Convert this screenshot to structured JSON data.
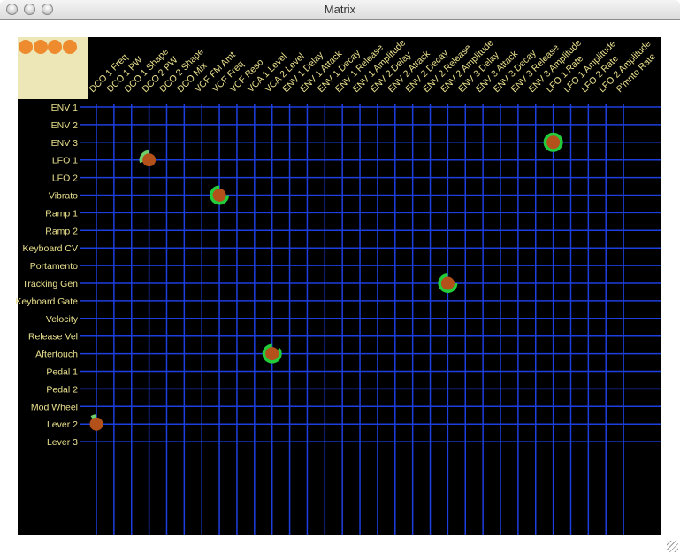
{
  "window": {
    "title": "Matrix"
  },
  "corner": {
    "indicator_count": 4,
    "indicator_color": "#ed8b2e"
  },
  "colors": {
    "grid": "#1e3fe0",
    "label": "#e9e08e",
    "dot": "#b4501a",
    "ring": "#22cc3a",
    "ring_dim": "#6ccf6a",
    "corner_bg": "#ede6b6"
  },
  "columns": [
    "DCO 1 Freq",
    "DCO 1 PW",
    "DCO 1 Shape",
    "DCO 2 PW",
    "DCO 2 Shape",
    "DCO Mix",
    "VCF FM Amt",
    "VCF Freq",
    "VCF Reso",
    "VCA 1 Level",
    "VCA 2 Level",
    "ENV 1 Delay",
    "ENV 1 Attack",
    "ENV 1 Decay",
    "ENV 1 Release",
    "ENV 1 Amplitude",
    "ENV 2 Delay",
    "ENV 2 Attack",
    "ENV 2 Decay",
    "ENV 2 Release",
    "ENV 2 Amplitude",
    "ENV 3 Delay",
    "ENV 3 Attack",
    "ENV 3 Decay",
    "ENV 3 Release",
    "ENV 3 Amplitude",
    "LFO 1 Rate",
    "LFO 1 Amplitude",
    "LFO 2 Rate",
    "LFO 2 Amplitude",
    "P'mnto Rate"
  ],
  "rows": [
    "ENV 1",
    "ENV 2",
    "ENV 3",
    "LFO 1",
    "LFO 2",
    "Vibrato",
    "Ramp 1",
    "Ramp 2",
    "Keyboard CV",
    "Portamento",
    "Tracking Gen",
    "Keyboard Gate",
    "Velocity",
    "Release Vel",
    "Aftertouch",
    "Pedal 1",
    "Pedal 2",
    "Mod Wheel",
    "Lever 2",
    "Lever 3"
  ],
  "connections": [
    {
      "source": "ENV 3",
      "destination": "LFO 1 Rate",
      "amount": 1.0
    },
    {
      "source": "LFO 1",
      "destination": "DCO 2 PW",
      "amount": 0.3
    },
    {
      "source": "Vibrato",
      "destination": "VCF Freq",
      "amount": 0.75
    },
    {
      "source": "Tracking Gen",
      "destination": "ENV 2 Amplitude",
      "amount": 0.75
    },
    {
      "source": "Aftertouch",
      "destination": "VCA 2 Level",
      "amount": 0.85
    },
    {
      "source": "Lever 2",
      "destination": "DCO 1 Freq",
      "amount": 0.1
    }
  ]
}
